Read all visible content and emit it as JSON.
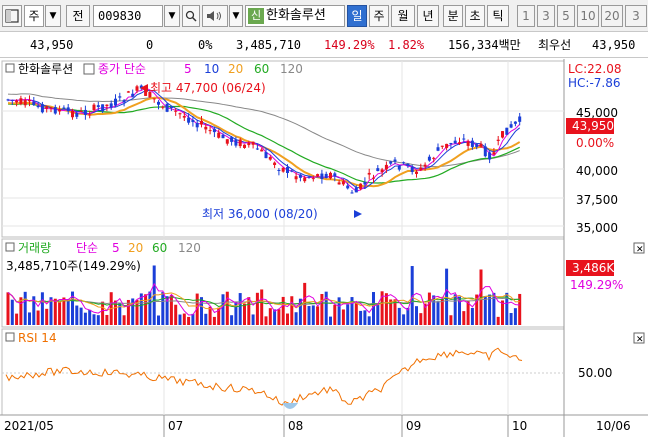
{
  "toolbar": {
    "type_label": "주",
    "prev_label": "전",
    "stock_code": "009830",
    "shin_badge": "신",
    "stock_name": "한화솔루션",
    "periods": [
      "일",
      "주",
      "월",
      "년",
      "분",
      "초",
      "틱"
    ],
    "active_period": "일",
    "minute_options": [
      "1",
      "3",
      "5",
      "10",
      "20",
      "3"
    ]
  },
  "price_bar": {
    "price": "43,950",
    "change": "0",
    "change_rate": "0%",
    "volume": "3,485,710",
    "volume_ratio": "149.29%",
    "turnover_rate": "1.82%",
    "amount": "156,334백만",
    "pref_label": "최우선",
    "pref_price": "43,950"
  },
  "price_panel": {
    "title": "한화솔루션",
    "indicator_label": "종가 단순",
    "ma_periods": [
      "5",
      "10",
      "20",
      "60",
      "120"
    ],
    "lc": "LC:22.08",
    "hc": "HC:-7.86",
    "high_annotation": "최고 47,700 (06/24)",
    "low_annotation": "최저 36,000 (08/20)",
    "y_ticks": [
      "45,000",
      "40,000",
      "37,500",
      "35,000"
    ],
    "current_price_tag": "43,950",
    "change_tag": "0.00%"
  },
  "volume_panel": {
    "title": "거래량",
    "indicator_label": "단순",
    "ma_periods": [
      "5",
      "20",
      "60",
      "120"
    ],
    "value_label": "3,485,710주(149.29%)",
    "tag_value": "3,486K",
    "tag_ratio": "149.29%"
  },
  "rsi_panel": {
    "title": "RSI 14",
    "y_tick": "50.00"
  },
  "x_axis": {
    "labels": [
      "2021/05",
      "07",
      "08",
      "09",
      "10"
    ],
    "right_date": "10/06"
  },
  "colors": {
    "up": "#e8121c",
    "down": "#1b3fd8",
    "ma5": "#e000e0",
    "ma10": "#1b3fd8",
    "ma20": "#f0a020",
    "ma60": "#22aa22",
    "ma120": "#888888",
    "rsi": "#f07000"
  }
}
